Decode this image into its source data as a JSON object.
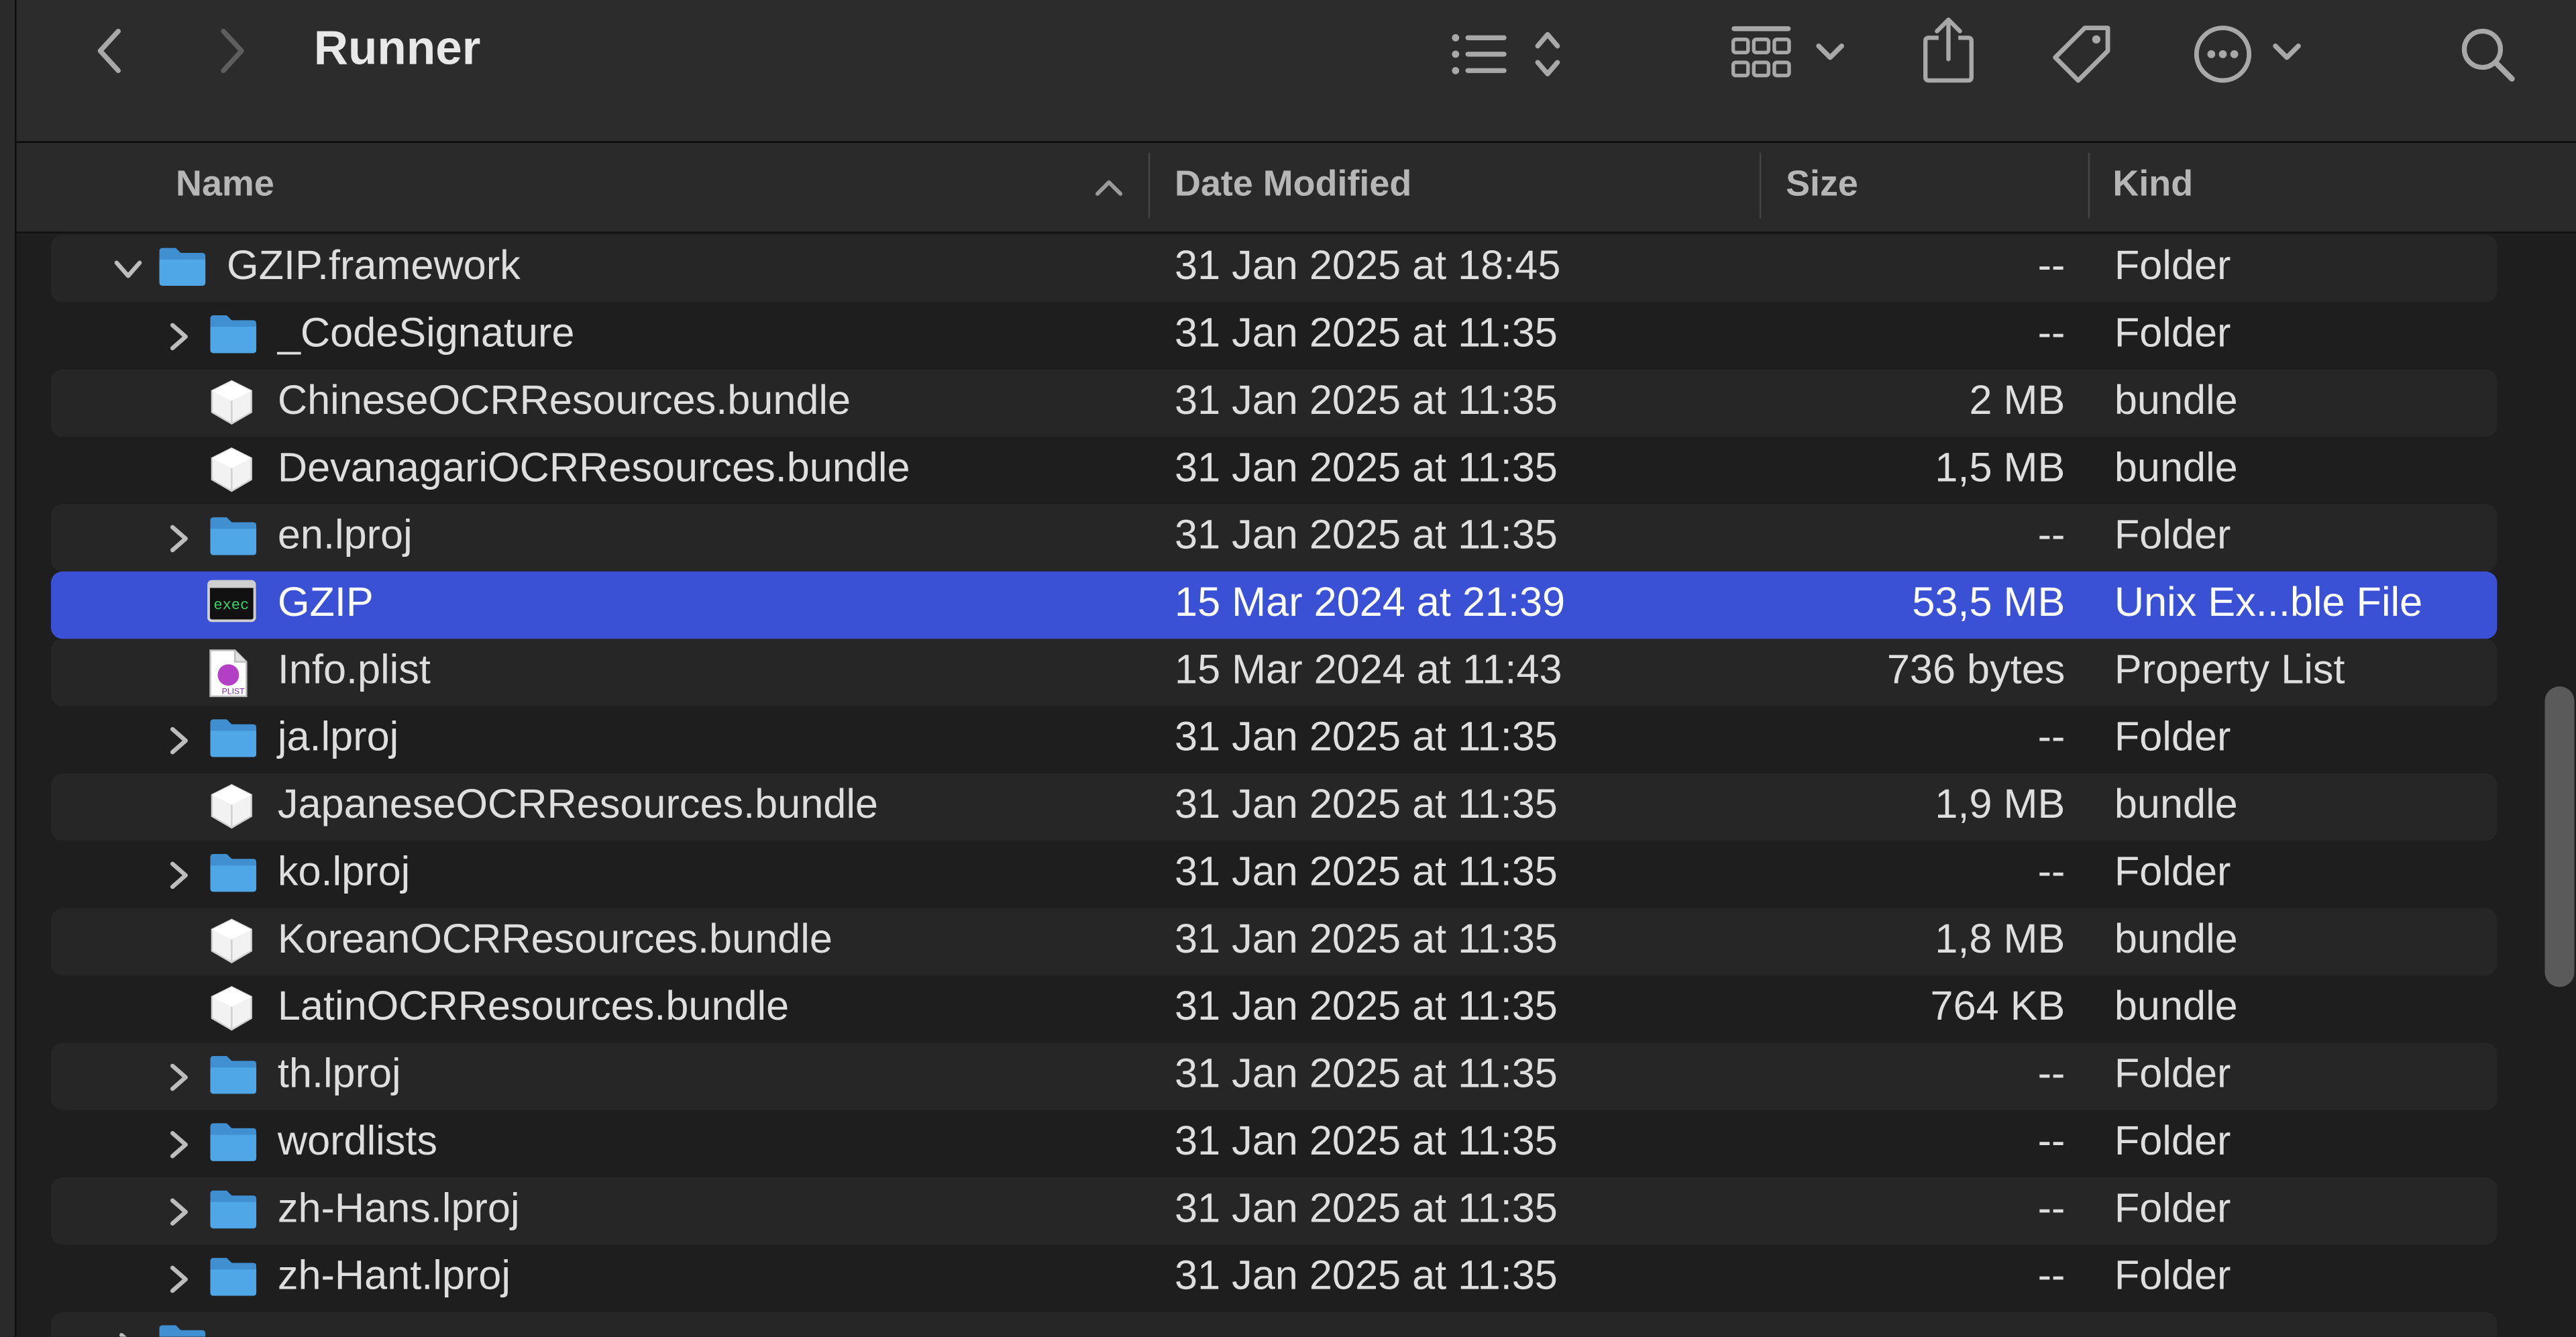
{
  "window": {
    "title": "Runner"
  },
  "toolbar": {
    "icons": [
      "back-icon",
      "forward-icon",
      "list-view-icon",
      "sort-arrows-icon",
      "group-icon",
      "chevron-down-icon",
      "share-icon",
      "tag-icon",
      "more-icon",
      "chevron-down-icon",
      "search-icon"
    ]
  },
  "columns": {
    "name": "Name",
    "date": "Date Modified",
    "size": "Size",
    "kind": "Kind"
  },
  "rows": [
    {
      "name": "GZIP.framework",
      "date": "31 Jan 2025 at 18:45",
      "size": "--",
      "kind": "Folder",
      "icon": "folder",
      "disclosure": "expanded",
      "level": 0
    },
    {
      "name": "_CodeSignature",
      "date": "31 Jan 2025 at 11:35",
      "size": "--",
      "kind": "Folder",
      "icon": "folder",
      "disclosure": "collapsed",
      "level": 1
    },
    {
      "name": "ChineseOCRResources.bundle",
      "date": "31 Jan 2025 at 11:35",
      "size": "2 MB",
      "kind": "bundle",
      "icon": "bundle",
      "disclosure": "none",
      "level": 1
    },
    {
      "name": "DevanagariOCRResources.bundle",
      "date": "31 Jan 2025 at 11:35",
      "size": "1,5 MB",
      "kind": "bundle",
      "icon": "bundle",
      "disclosure": "none",
      "level": 1
    },
    {
      "name": "en.lproj",
      "date": "31 Jan 2025 at 11:35",
      "size": "--",
      "kind": "Folder",
      "icon": "folder",
      "disclosure": "collapsed",
      "level": 1
    },
    {
      "name": "GZIP",
      "date": "15 Mar 2024 at 21:39",
      "size": "53,5 MB",
      "kind": "Unix Ex...ble File",
      "icon": "exec",
      "disclosure": "none",
      "level": 1,
      "selected": true
    },
    {
      "name": "Info.plist",
      "date": "15 Mar 2024 at 11:43",
      "size": "736 bytes",
      "kind": "Property List",
      "icon": "plist",
      "disclosure": "none",
      "level": 1
    },
    {
      "name": "ja.lproj",
      "date": "31 Jan 2025 at 11:35",
      "size": "--",
      "kind": "Folder",
      "icon": "folder",
      "disclosure": "collapsed",
      "level": 1
    },
    {
      "name": "JapaneseOCRResources.bundle",
      "date": "31 Jan 2025 at 11:35",
      "size": "1,9 MB",
      "kind": "bundle",
      "icon": "bundle",
      "disclosure": "none",
      "level": 1
    },
    {
      "name": "ko.lproj",
      "date": "31 Jan 2025 at 11:35",
      "size": "--",
      "kind": "Folder",
      "icon": "folder",
      "disclosure": "collapsed",
      "level": 1
    },
    {
      "name": "KoreanOCRResources.bundle",
      "date": "31 Jan 2025 at 11:35",
      "size": "1,8 MB",
      "kind": "bundle",
      "icon": "bundle",
      "disclosure": "none",
      "level": 1
    },
    {
      "name": "LatinOCRResources.bundle",
      "date": "31 Jan 2025 at 11:35",
      "size": "764 KB",
      "kind": "bundle",
      "icon": "bundle",
      "disclosure": "none",
      "level": 1
    },
    {
      "name": "th.lproj",
      "date": "31 Jan 2025 at 11:35",
      "size": "--",
      "kind": "Folder",
      "icon": "folder",
      "disclosure": "collapsed",
      "level": 1
    },
    {
      "name": "wordlists",
      "date": "31 Jan 2025 at 11:35",
      "size": "--",
      "kind": "Folder",
      "icon": "folder",
      "disclosure": "collapsed",
      "level": 1
    },
    {
      "name": "zh-Hans.lproj",
      "date": "31 Jan 2025 at 11:35",
      "size": "--",
      "kind": "Folder",
      "icon": "folder",
      "disclosure": "collapsed",
      "level": 1
    },
    {
      "name": "zh-Hant.lproj",
      "date": "31 Jan 2025 at 11:35",
      "size": "--",
      "kind": "Folder",
      "icon": "folder",
      "disclosure": "collapsed",
      "level": 1
    },
    {
      "name": "",
      "date": "",
      "size": "",
      "kind": "",
      "icon": "folder",
      "disclosure": "collapsed",
      "level": 0,
      "clipped": true
    }
  ],
  "colors": {
    "selection": "#3a51d6",
    "folder": "#4fa7e8",
    "background": "#1e1e1e",
    "toolbar": "#2c2c2c"
  }
}
